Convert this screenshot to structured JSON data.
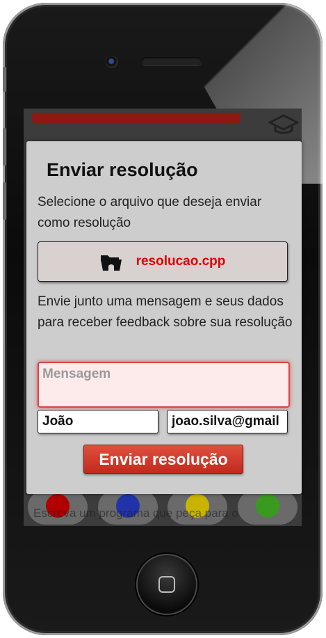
{
  "modal": {
    "title": "Enviar resolução",
    "instruction": "Selecione o arquivo que deseja enviar como resolução",
    "file_button": {
      "icon": "folder-open-icon",
      "filename": "resolucao.cpp"
    },
    "feedback_text": "Envie junto uma mensagem e seus dados para receber feedback sobre sua resolução",
    "message": {
      "placeholder": "Mensagem",
      "value": ""
    },
    "name_value": "João",
    "email_value": "joao.silva@gmail",
    "submit_label": "Enviar resolução"
  },
  "background": {
    "problem_text": "Escreva um programa que peça para o",
    "circle_icons": [
      "red-icon",
      "blue-icon",
      "yellow-icon",
      "green-icon"
    ],
    "circle_colors": [
      "#b00000",
      "#2233aa",
      "#c8b400",
      "#3a9a20"
    ]
  },
  "colors": {
    "accent": "#d43020",
    "filename": "#e00000"
  }
}
